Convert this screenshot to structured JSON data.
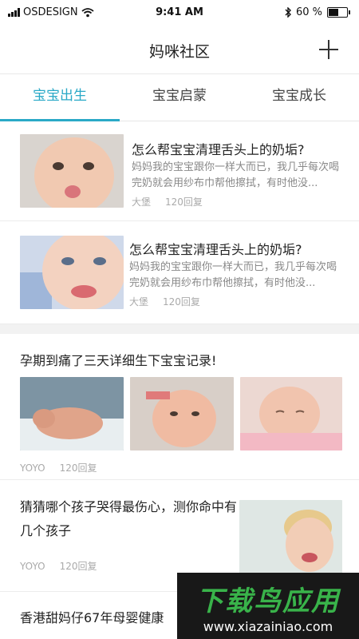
{
  "status_bar": {
    "carrier": "OSDESIGN",
    "time": "9:41 AM",
    "battery": "60 %",
    "battery_level": 0.6
  },
  "nav": {
    "title": "妈咪社区",
    "add_icon": "plus-icon"
  },
  "tabs": [
    {
      "label": "宝宝出生",
      "active": true
    },
    {
      "label": "宝宝启蒙",
      "active": false
    },
    {
      "label": "宝宝成长",
      "active": false
    }
  ],
  "colors": {
    "accent": "#2aa9c7",
    "watermark_green": "#39b34a"
  },
  "posts": [
    {
      "title": "怎么帮宝宝清理舌头上的奶垢?",
      "excerpt": "妈妈我的宝宝跟你一样大而已，我几乎每次喝完奶就会用纱布巾帮他擦拭，有时他没...",
      "author": "大堡",
      "replies": "120回复"
    },
    {
      "title": "怎么帮宝宝清理舌头上的奶垢?",
      "excerpt": "妈妈我的宝宝跟你一样大而已，我几乎每次喝完奶就会用纱布巾帮他擦拭，有时他没...",
      "author": "大堡",
      "replies": "120回复"
    },
    {
      "title": "孕期到痛了三天详细生下宝宝记录!",
      "author": "YOYO",
      "replies": "120回复"
    },
    {
      "title": "猜猜哪个孩子哭得最伤心，测你命中有几个孩子",
      "author": "YOYO",
      "replies": "120回复"
    },
    {
      "title": "香港甜妈仔67年母婴健康"
    }
  ],
  "watermark": {
    "logo": "下载鸟应用",
    "url": "www.xiazainiao.com"
  }
}
